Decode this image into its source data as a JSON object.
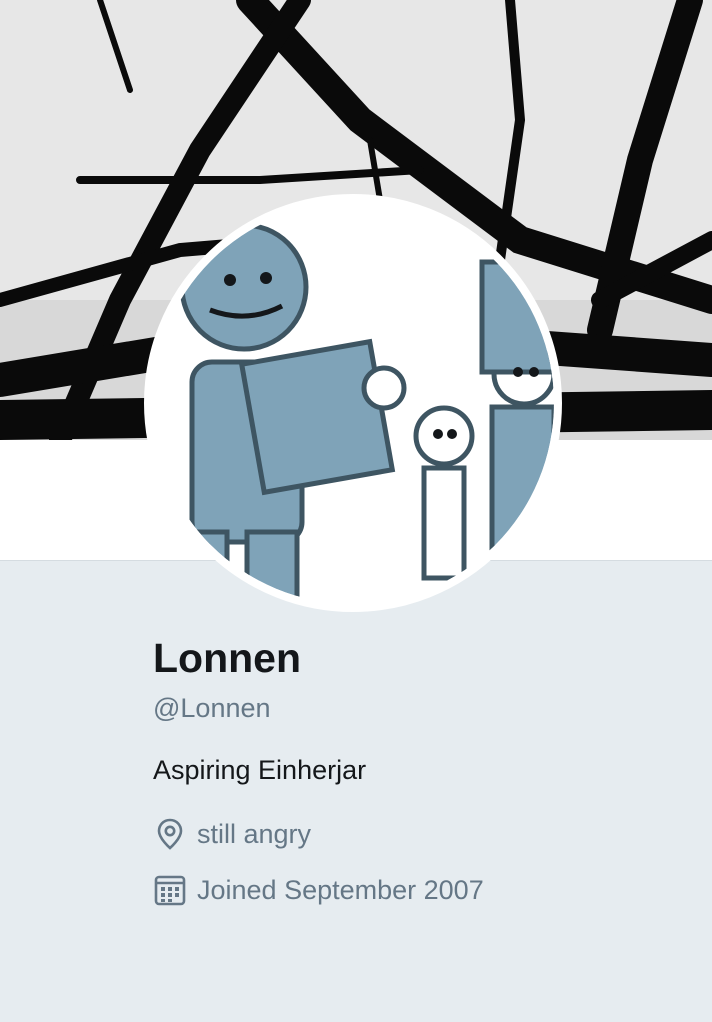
{
  "profile": {
    "name": "Lonnen",
    "handle": "@Lonnen",
    "bio": "Aspiring Einherjar",
    "location": "still angry",
    "joined": "Joined September 2007",
    "location_icon": "map-pin-icon",
    "joined_icon": "calendar-icon"
  },
  "colors": {
    "page_bg": "#e6ecf0",
    "text_primary": "#14171a",
    "text_secondary": "#657786",
    "avatar_art": "#7fa3b8"
  }
}
